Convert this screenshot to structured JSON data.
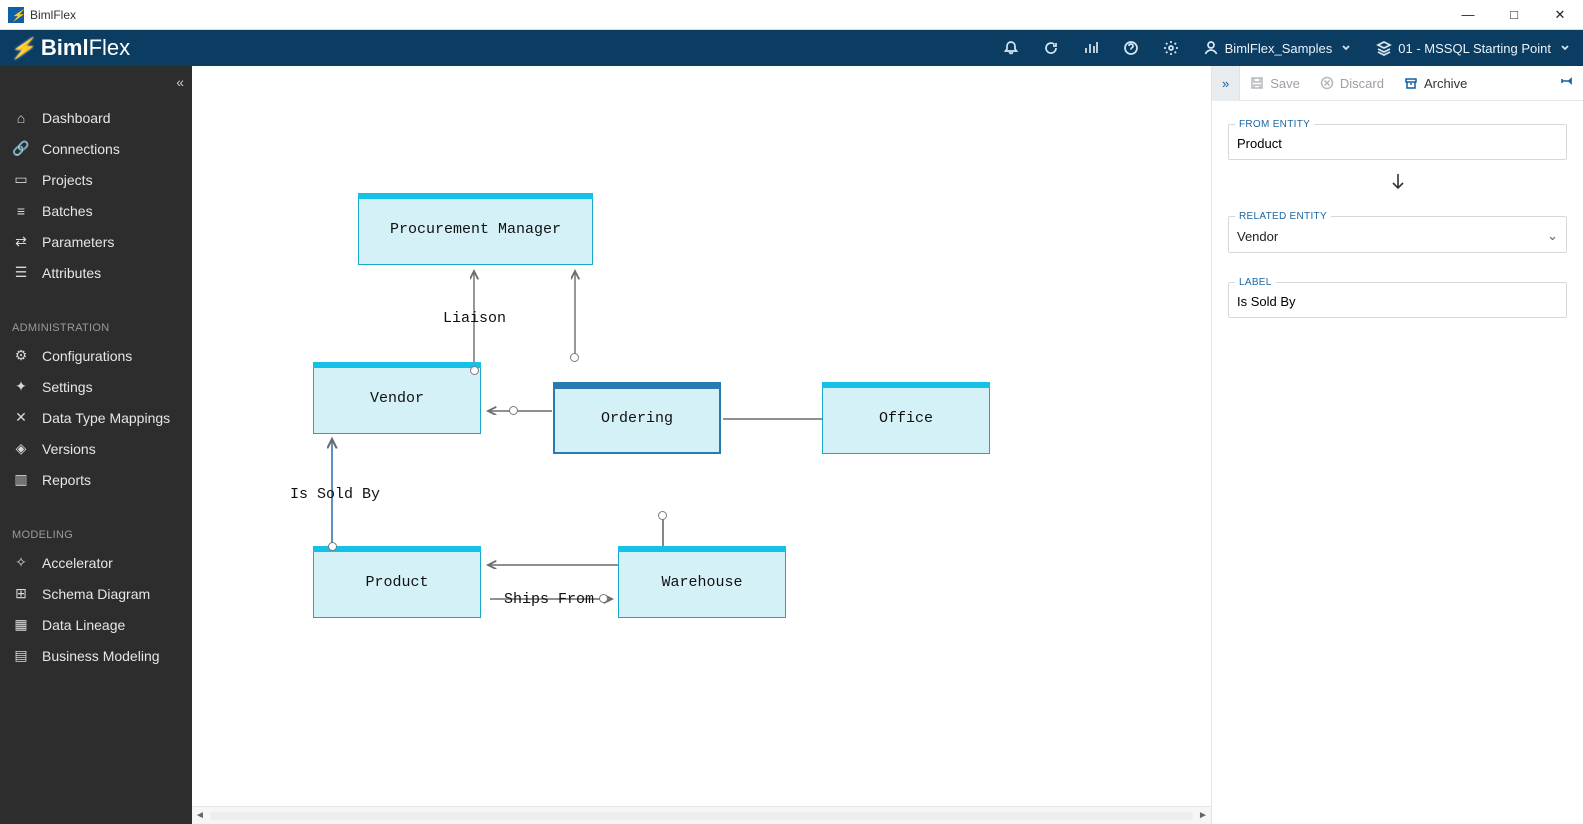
{
  "window": {
    "title": "BimlFlex"
  },
  "brand": {
    "part1": "Biml",
    "part2": "Flex"
  },
  "topbar": {
    "customer": "BimlFlex_Samples",
    "version": "01 - MSSQL Starting Point"
  },
  "sidebar": {
    "groups": [
      {
        "label": null,
        "items": [
          {
            "icon": "home",
            "label": "Dashboard"
          },
          {
            "icon": "link",
            "label": "Connections"
          },
          {
            "icon": "proj",
            "label": "Projects"
          },
          {
            "icon": "batch",
            "label": "Batches"
          },
          {
            "icon": "param",
            "label": "Parameters"
          },
          {
            "icon": "attr",
            "label": "Attributes"
          }
        ]
      },
      {
        "label": "ADMINISTRATION",
        "items": [
          {
            "icon": "cog",
            "label": "Configurations"
          },
          {
            "icon": "gear",
            "label": "Settings"
          },
          {
            "icon": "map",
            "label": "Data Type Mappings"
          },
          {
            "icon": "ver",
            "label": "Versions"
          },
          {
            "icon": "rep",
            "label": "Reports"
          }
        ]
      },
      {
        "label": "MODELING",
        "items": [
          {
            "icon": "acc",
            "label": "Accelerator"
          },
          {
            "icon": "sch",
            "label": "Schema Diagram"
          },
          {
            "icon": "lin",
            "label": "Data Lineage"
          },
          {
            "icon": "bus",
            "label": "Business Modeling"
          }
        ]
      }
    ]
  },
  "diagram": {
    "nodes": {
      "procmgr": "Procurement Manager",
      "vendor": "Vendor",
      "ordering": "Ordering",
      "office": "Office",
      "product": "Product",
      "warehouse": "Warehouse"
    },
    "edgeLabels": {
      "liaison": "Liaison",
      "issoldby": "Is Sold By",
      "shipsfrom": "Ships From"
    }
  },
  "panel": {
    "actions": {
      "save": "Save",
      "discard": "Discard",
      "archive": "Archive"
    },
    "fields": {
      "fromEntity": {
        "legend": "FROM ENTITY",
        "value": "Product"
      },
      "relatedEntity": {
        "legend": "RELATED ENTITY",
        "value": "Vendor"
      },
      "label": {
        "legend": "LABEL",
        "value": "Is Sold By"
      }
    }
  }
}
